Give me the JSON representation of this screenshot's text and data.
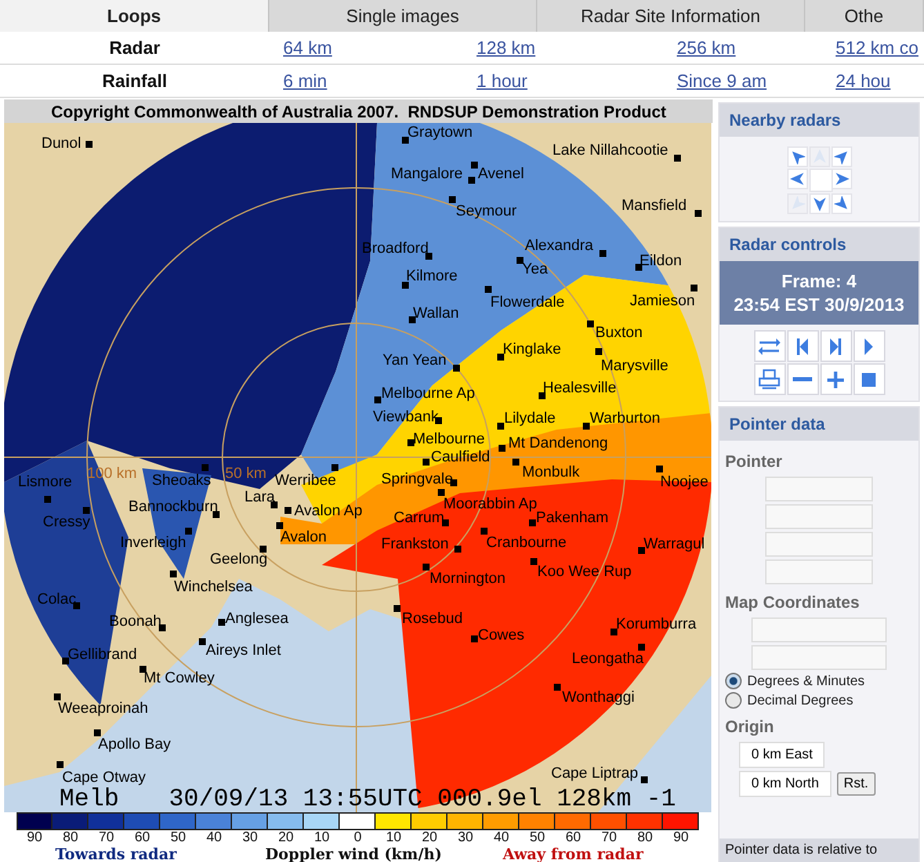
{
  "tabs": [
    {
      "label": "Loops",
      "selected": true
    },
    {
      "label": "Single images",
      "selected": false
    },
    {
      "label": "Radar Site Information",
      "selected": false
    },
    {
      "label": "Othe",
      "selected": false
    }
  ],
  "link_rows": [
    {
      "label": "Radar",
      "links": [
        "64 km",
        "128 km",
        "256 km",
        "512 km co"
      ]
    },
    {
      "label": "Rainfall",
      "links": [
        "6 min",
        "1 hour",
        "Since 9 am",
        "24 hou"
      ]
    }
  ],
  "map": {
    "copyright": "Copyright Commonwealth of Australia 2007.  RNDSUP Demonstration Product",
    "ring_labels": [
      "100 km",
      "50 km"
    ],
    "towns": [
      "Dunol",
      "Graytown",
      "Lake Nillahcootie",
      "Mangalore",
      "Avenel",
      "Seymour",
      "Mansfield",
      "Broadford",
      "Alexandra",
      "Yea",
      "Eildon",
      "Kilmore",
      "Flowerdale",
      "Jamieson",
      "Wallan",
      "Buxton",
      "Kinglake",
      "Marysville",
      "Yan Yean",
      "Healesville",
      "Melbourne Ap",
      "Viewbank",
      "Lilydale",
      "Warburton",
      "Melbourne",
      "Mt Dandenong",
      "Caulfield",
      "Monbulk",
      "Springvale",
      "Noojee",
      "Moorabbin Ap",
      "Carrum",
      "Pakenham",
      "Frankston",
      "Cranbourne",
      "Warragul",
      "Koo Wee Rup",
      "Mornington",
      "Rosebud",
      "Korumburra",
      "Cowes",
      "Leongatha",
      "Wonthaggi",
      "Cape Liptrap",
      "Lismore",
      "Sheoaks",
      "Werribee",
      "Lara",
      "Bannockburn",
      "Avalon Ap",
      "Cressy",
      "Avalon",
      "Inverleigh",
      "Geelong",
      "Winchelsea",
      "Colac",
      "Boonah",
      "Anglesea",
      "Aireys Inlet",
      "Gellibrand",
      "Mt Cowley",
      "Weeaproinah",
      "Apollo Bay",
      "Cape Otway"
    ],
    "station": "Melb",
    "caption": "30/09/13 13:55UTC 000.9el 128km -1"
  },
  "legend": {
    "bins": [
      {
        "label": "90",
        "color": "#00004f"
      },
      {
        "label": "80",
        "color": "#0a1c78"
      },
      {
        "label": "70",
        "color": "#10309a"
      },
      {
        "label": "60",
        "color": "#1e4cb4"
      },
      {
        "label": "50",
        "color": "#2f66c8"
      },
      {
        "label": "40",
        "color": "#4a82d8"
      },
      {
        "label": "30",
        "color": "#66a0e4"
      },
      {
        "label": "20",
        "color": "#86bcee"
      },
      {
        "label": "10",
        "color": "#a8d6f6"
      },
      {
        "label": "0",
        "color": "#ffffff"
      },
      {
        "label": "10",
        "color": "#ffe600"
      },
      {
        "label": "20",
        "color": "#ffcc00"
      },
      {
        "label": "30",
        "color": "#ffb400"
      },
      {
        "label": "40",
        "color": "#ff9c00"
      },
      {
        "label": "50",
        "color": "#ff8200"
      },
      {
        "label": "60",
        "color": "#ff6a00"
      },
      {
        "label": "70",
        "color": "#ff5000"
      },
      {
        "label": "80",
        "color": "#ff3200"
      },
      {
        "label": "90",
        "color": "#ff1400"
      }
    ],
    "towards": "Towards radar",
    "title": "Doppler wind (km/h)",
    "away": "Away from radar"
  },
  "sidebar": {
    "nearby_title": "Nearby radars",
    "nearby": [
      {
        "kind": "northwest",
        "disabled": false
      },
      {
        "kind": "north",
        "disabled": true
      },
      {
        "kind": "northeast",
        "disabled": false
      },
      {
        "kind": "west",
        "disabled": false
      },
      {
        "kind": "east",
        "disabled": false
      },
      {
        "kind": "southwest",
        "disabled": true
      },
      {
        "kind": "south",
        "disabled": false
      },
      {
        "kind": "southeast",
        "disabled": false
      }
    ],
    "controls_title": "Radar controls",
    "frame": "Frame: 4",
    "time": "23:54 EST 30/9/2013",
    "controls": [
      {
        "kind": "swap"
      },
      {
        "kind": "first"
      },
      {
        "kind": "last"
      },
      {
        "kind": "play"
      },
      {
        "kind": "print"
      },
      {
        "kind": "minus"
      },
      {
        "kind": "plus"
      },
      {
        "kind": "stop"
      }
    ],
    "pointer_title": "Pointer data",
    "pointer_label": "Pointer",
    "coords_label": "Map Coordinates",
    "formats": [
      {
        "label": "Degrees & Minutes",
        "selected": true
      },
      {
        "label": "Decimal Degrees",
        "selected": false
      }
    ],
    "origin_label": "Origin",
    "east": "0 km East",
    "north": "0 km North",
    "reset": "Rst.",
    "footer": "Pointer data is relative to"
  }
}
